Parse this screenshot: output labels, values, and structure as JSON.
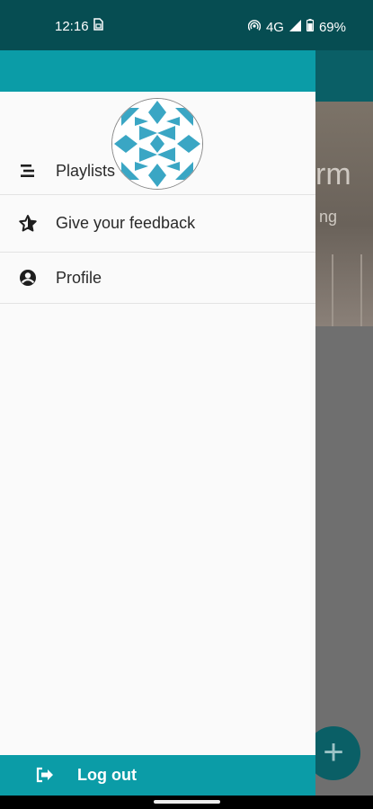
{
  "status_bar": {
    "time": "12:16",
    "network": "4G",
    "battery": "69%",
    "icons": [
      "sim-icon",
      "hotspot-icon",
      "signal-icon",
      "battery-icon"
    ]
  },
  "background_app": {
    "hero_title": "rm",
    "hero_subtitle": "ng",
    "fab_label": "+"
  },
  "drawer": {
    "menu": [
      {
        "label": "Playlists",
        "icon": "list-icon"
      },
      {
        "label": "Give your feedback",
        "icon": "star-icon"
      },
      {
        "label": "Profile",
        "icon": "account-icon"
      }
    ],
    "logout": {
      "label": "Log out",
      "icon": "logout-icon"
    }
  },
  "colors": {
    "header_teal": "#0b9ca7",
    "statusbar": "#064d52",
    "scrim": "#6f6f6f"
  }
}
